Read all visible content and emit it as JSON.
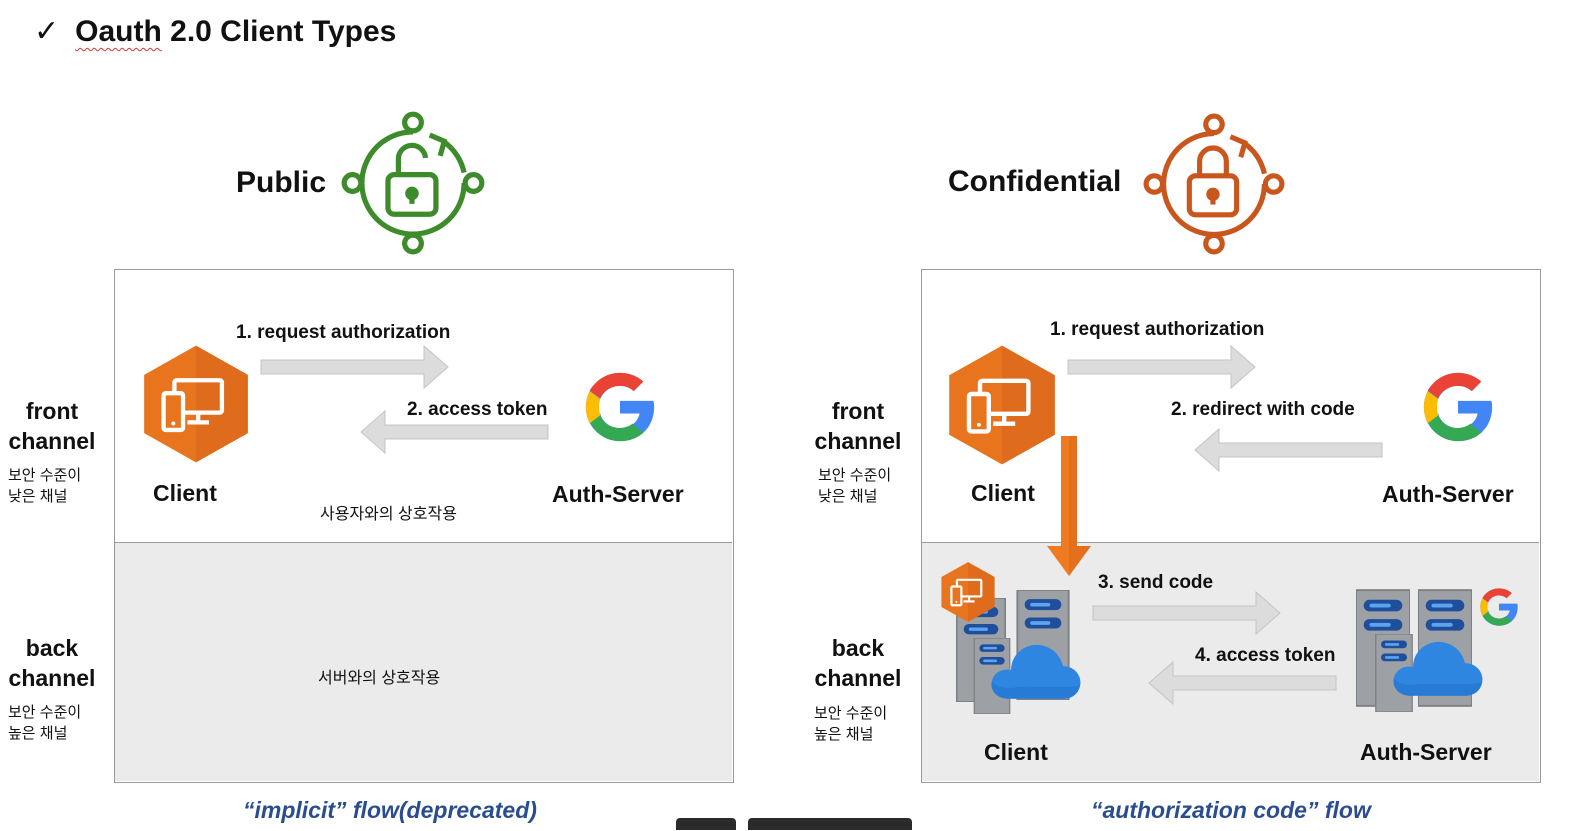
{
  "title": {
    "check": "✓",
    "oauth": "Oauth",
    "rest": " 2.0 Client Types"
  },
  "public": {
    "heading": "Public",
    "front": {
      "channel": [
        "front",
        "channel"
      ],
      "note": [
        "보안 수준이",
        "낮은 채널"
      ]
    },
    "back": {
      "channel": [
        "back",
        "channel"
      ],
      "note": [
        "보안 수준이",
        "높은 채널"
      ]
    },
    "step1": "1. request authorization",
    "step2": "2. access token",
    "client": "Client",
    "server": "Auth-Server",
    "front_interaction": "사용자와의 상호작용",
    "back_interaction": "서버와의 상호작용",
    "caption": "“implicit” flow(deprecated)"
  },
  "confidential": {
    "heading": "Confidential",
    "front": {
      "channel": [
        "front",
        "channel"
      ],
      "note": [
        "보안 수준이",
        "낮은 채널"
      ]
    },
    "back": {
      "channel": [
        "back",
        "channel"
      ],
      "note": [
        "보안 수준이",
        "높은 채널"
      ]
    },
    "step1": "1. request authorization",
    "step2": "2. redirect with code",
    "step3": "3. send code",
    "step4": "4. access token",
    "client": "Client",
    "server": "Auth-Server",
    "back_client": "Client",
    "back_server": "Auth-Server",
    "caption": "“authorization code” flow"
  },
  "colors": {
    "public_icon": "#3d8b2a",
    "confidential_icon": "#c9571d",
    "client_hex": "#e8741e",
    "arrow_gray": "#dcdcdc",
    "arrow_orange": "#ef7a20",
    "caption": "#2a4d8f",
    "cloud": "#2f86e0"
  },
  "icons": [
    "lock-open-cycle-icon",
    "lock-closed-cycle-icon",
    "client-device-icon",
    "google-logo-icon",
    "server-rack-icon",
    "cloud-icon"
  ]
}
